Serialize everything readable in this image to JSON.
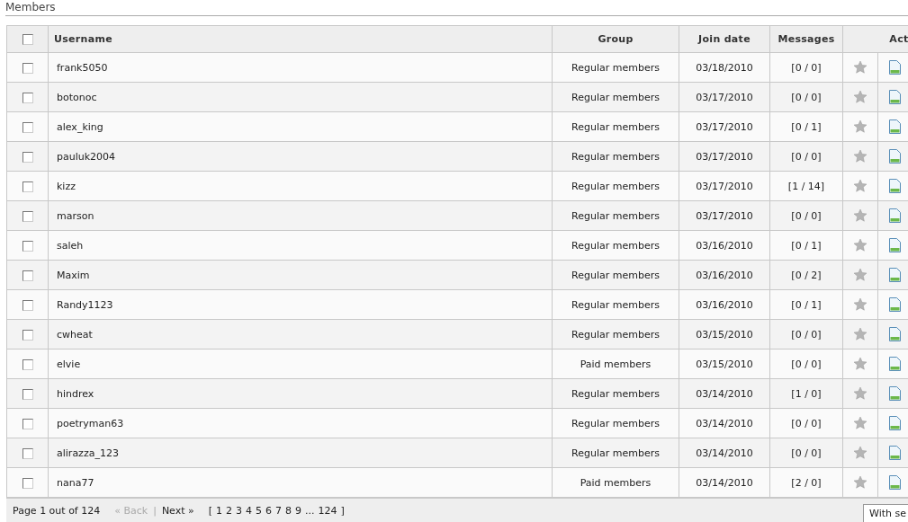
{
  "section_title": "Members",
  "table": {
    "select_all": {
      "checked": false
    },
    "columns": [
      "Username",
      "Group",
      "Join date",
      "Messages",
      "Act"
    ],
    "rows": [
      {
        "checked": false,
        "username": "frank5050",
        "group": "Regular members",
        "join_date": "03/18/2010",
        "messages": "[0 / 0]"
      },
      {
        "checked": false,
        "username": "botonoc",
        "group": "Regular members",
        "join_date": "03/17/2010",
        "messages": "[0 / 0]"
      },
      {
        "checked": false,
        "username": "alex_king",
        "group": "Regular members",
        "join_date": "03/17/2010",
        "messages": "[0 / 1]"
      },
      {
        "checked": false,
        "username": "pauluk2004",
        "group": "Regular members",
        "join_date": "03/17/2010",
        "messages": "[0 / 0]"
      },
      {
        "checked": false,
        "username": "kizz",
        "group": "Regular members",
        "join_date": "03/17/2010",
        "messages": "[1 / 14]"
      },
      {
        "checked": false,
        "username": "marson",
        "group": "Regular members",
        "join_date": "03/17/2010",
        "messages": "[0 / 0]"
      },
      {
        "checked": false,
        "username": "saleh",
        "group": "Regular members",
        "join_date": "03/16/2010",
        "messages": "[0 / 1]"
      },
      {
        "checked": false,
        "username": "Maxim",
        "group": "Regular members",
        "join_date": "03/16/2010",
        "messages": "[0 / 2]"
      },
      {
        "checked": false,
        "username": "Randy1123",
        "group": "Regular members",
        "join_date": "03/16/2010",
        "messages": "[0 / 1]"
      },
      {
        "checked": false,
        "username": "cwheat",
        "group": "Regular members",
        "join_date": "03/15/2010",
        "messages": "[0 / 0]"
      },
      {
        "checked": false,
        "username": "elvie",
        "group": "Paid members",
        "join_date": "03/15/2010",
        "messages": "[0 / 0]"
      },
      {
        "checked": false,
        "username": "hindrex",
        "group": "Regular members",
        "join_date": "03/14/2010",
        "messages": "[1 / 0]"
      },
      {
        "checked": false,
        "username": "poetryman63",
        "group": "Regular members",
        "join_date": "03/14/2010",
        "messages": "[0 / 0]"
      },
      {
        "checked": false,
        "username": "alirazza_123",
        "group": "Regular members",
        "join_date": "03/14/2010",
        "messages": "[0 / 0]"
      },
      {
        "checked": false,
        "username": "nana77",
        "group": "Paid members",
        "join_date": "03/14/2010",
        "messages": "[2 / 0]"
      }
    ]
  },
  "pagination": {
    "summary": "Page 1 out of 124",
    "back": {
      "label": "« Back",
      "disabled": true
    },
    "separator": "|",
    "next": {
      "label": "Next »",
      "disabled": false
    },
    "open_bracket": "[",
    "pages": [
      "1",
      "2",
      "3",
      "4",
      "5",
      "6",
      "7",
      "8",
      "9",
      "...",
      "124"
    ],
    "close_bracket": "]"
  },
  "bulk_action": {
    "value": "With se"
  }
}
